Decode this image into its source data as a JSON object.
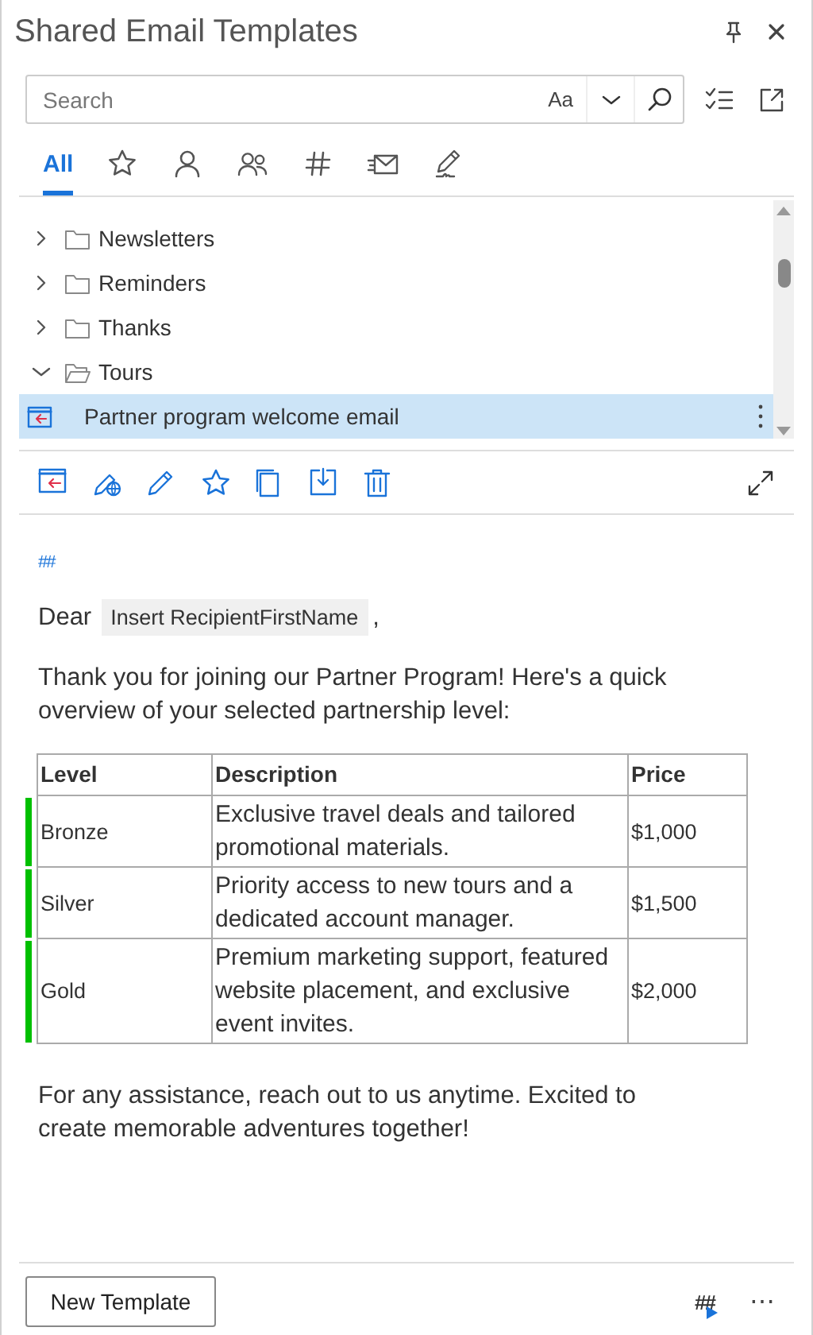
{
  "pane": {
    "title": "Shared Email Templates"
  },
  "search": {
    "placeholder": "Search",
    "match_case": "Aa"
  },
  "tabs": [
    {
      "kind": "text",
      "label": "All",
      "selected": true
    },
    {
      "kind": "star",
      "selected": false
    },
    {
      "kind": "person",
      "selected": false
    },
    {
      "kind": "people",
      "selected": false
    },
    {
      "kind": "hash",
      "selected": false
    },
    {
      "kind": "mail",
      "selected": false
    },
    {
      "kind": "signature",
      "selected": false
    }
  ],
  "tree": [
    {
      "label": "Newsletters",
      "expanded": false,
      "selected": false
    },
    {
      "label": "Reminders",
      "expanded": false,
      "selected": false
    },
    {
      "label": "Thanks",
      "expanded": false,
      "selected": false
    },
    {
      "label": "Tours",
      "expanded": true,
      "selected": false,
      "children": [
        {
          "label": "Partner program welcome email",
          "selected": true
        }
      ]
    }
  ],
  "preview": {
    "marker": "##",
    "greeting": "Dear",
    "field_chip": "Insert RecipientFirstName",
    "greeting_end": ",",
    "intro": "Thank you for joining our Partner Program! Here's a quick overview of your selected partnership level:",
    "table": {
      "columns": [
        "Level",
        "Description",
        "Price"
      ],
      "rows": [
        [
          "Bronze",
          "Exclusive travel deals and tailored promotional materials.",
          "$1,000"
        ],
        [
          "Silver",
          "Priority access to new tours and a dedicated account manager.",
          "$1,500"
        ],
        [
          "Gold",
          "Premium marketing support, featured website placement, and exclusive event invites.",
          "$2,000"
        ]
      ]
    },
    "closing": "For any assistance, reach out to us anytime. Excited to create memorable adventures together!"
  },
  "footer": {
    "new_button": "New Template",
    "macro_label": "##",
    "more": "⋯"
  }
}
